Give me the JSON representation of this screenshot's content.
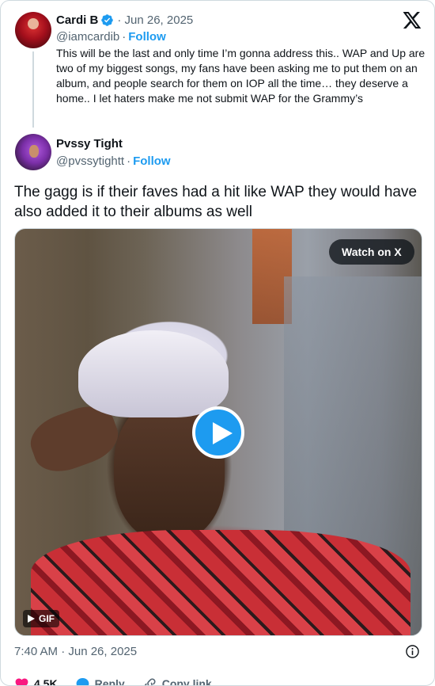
{
  "quoted_tweet": {
    "display_name": "Cardi B",
    "date": "Jun 26, 2025",
    "handle": "@iamcardib",
    "follow_label": "Follow",
    "text": "This will be the last and only time I’m gonna address this.. WAP and Up are two of my biggest songs, my fans have been asking me to put them on an album,  and people search for them on IOP all the time… they deserve a home.. I let haters make me not submit WAP for the Grammy’s"
  },
  "tweet": {
    "display_name": "Pvssy Tight",
    "handle": "@pvssytightt",
    "follow_label": "Follow",
    "text": "The gagg is if their faves had a hit like WAP they would have also added it to their albums as well",
    "timestamp": "7:40 AM · Jun 26, 2025"
  },
  "media": {
    "watch_label": "Watch on X",
    "gif_label": "GIF"
  },
  "actions": {
    "like_count": "4.5K",
    "reply_label": "Reply",
    "copy_label": "Copy link"
  },
  "colors": {
    "accent": "#1d9bf0",
    "text": "#0f1419",
    "secondary": "#536471",
    "like": "#f91880"
  },
  "icons": {
    "brand": "x-logo-icon",
    "verified": "verified-badge-icon",
    "play": "play-icon",
    "info": "info-icon",
    "like": "heart-icon",
    "reply": "reply-icon",
    "copy": "link-icon"
  }
}
